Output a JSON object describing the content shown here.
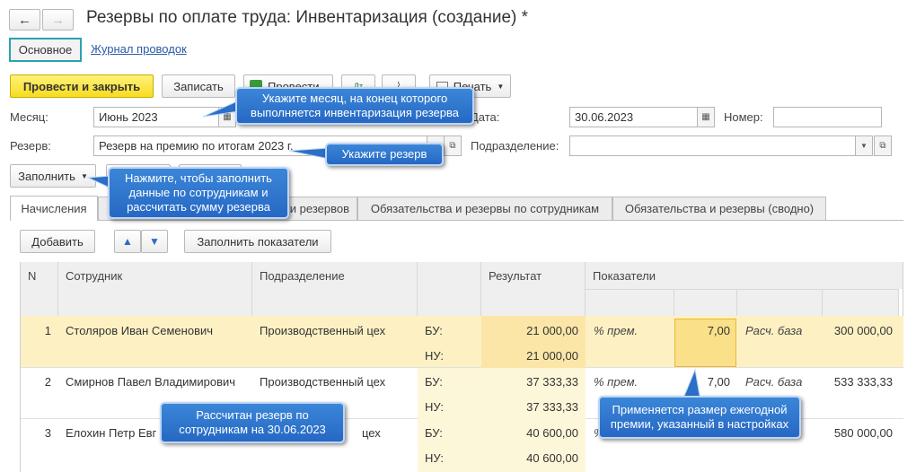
{
  "window": {
    "title": "Резервы по оплате труда: Инвентаризация (создание) *",
    "nav_back": "←",
    "nav_forward": "→"
  },
  "view_tabs": [
    "Основное",
    "Журнал проводок"
  ],
  "toolbar": {
    "post_close": "Провести и закрыть",
    "save": "Записать",
    "post": "Провести",
    "print": "Печать"
  },
  "form": {
    "month_label": "Месяц:",
    "month_value": "Июнь 2023",
    "date_label": "Дата:",
    "date_value": "30.06.2023",
    "number_label": "Номер:",
    "number_value": "",
    "reserve_label": "Резерв:",
    "reserve_value": "Резерв на премию по итогам 2023 г.",
    "department_label": "Подразделение:",
    "department_value": "",
    "fill_button": "Заполнить"
  },
  "callouts": {
    "month": "Укажите месяц, на конец которого выполняется инвентаризация резерва",
    "reserve": "Укажите резерв",
    "fill": "Нажмите, чтобы заполнить данные по сотрудникам и рассчитать сумму резерва",
    "calculated": "Рассчитан резерв по сотрудникам на 30.06.2023",
    "bonus": "Применяется размер ежегодной премии, указанный в настройках"
  },
  "tabs": {
    "accruals": "Начисления",
    "reserves_partial": "и резервов",
    "by_employee": "Обязательства и резервы по сотрудникам",
    "summary": "Обязательства и резервы (сводно)"
  },
  "table_toolbar": {
    "add": "Добавить",
    "fill_indicators": "Заполнить показатели"
  },
  "table": {
    "headers": {
      "n": "N",
      "employee": "Сотрудник",
      "department": "Подразделение",
      "result": "Результат",
      "indicators": "Показатели"
    },
    "rows": [
      {
        "n": "1",
        "employee": "Столяров Иван Семенович",
        "department": "Производственный цех",
        "bu_label": "БУ:",
        "nu_label": "НУ:",
        "bu": "21 000,00",
        "nu": "21 000,00",
        "ind1_name": "% прем.",
        "ind1_value": "7,00",
        "ind2_name": "Расч. база",
        "ind2_value": "300 000,00"
      },
      {
        "n": "2",
        "employee": "Смирнов Павел Владимирович",
        "department": "Производственный цех",
        "bu_label": "БУ:",
        "nu_label": "НУ:",
        "bu": "37 333,33",
        "nu": "37 333,33",
        "ind1_name": "% прем.",
        "ind1_value": "7,00",
        "ind2_name": "Расч. база",
        "ind2_value": "533 333,33"
      },
      {
        "n": "3",
        "employee": "Елохин Петр Евг",
        "department": "цех",
        "bu_label": "БУ:",
        "nu_label": "НУ:",
        "bu": "40 600,00",
        "nu": "40 600,00",
        "ind1_name": "%",
        "ind1_value": "",
        "ind2_name": "",
        "ind2_value": "580 000,00"
      }
    ]
  },
  "colors": {
    "primary_button": "#f7dc21",
    "selected_row": "#fdf1c4",
    "callout": "#2f79d0",
    "focus_border": "#2aa3b0"
  }
}
